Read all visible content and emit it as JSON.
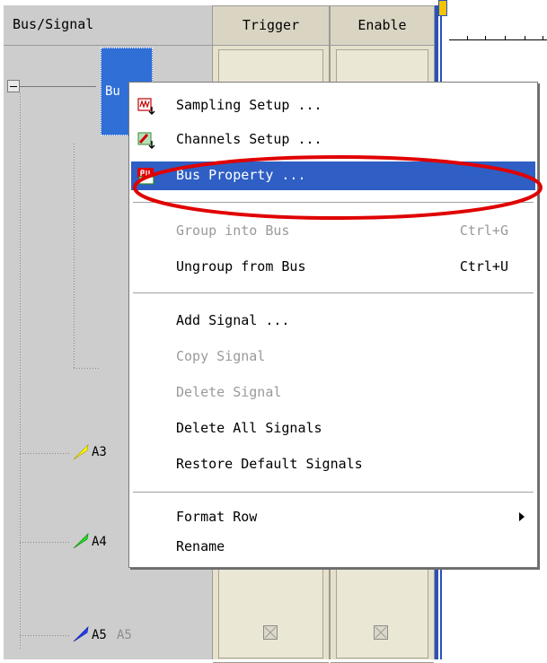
{
  "columns": {
    "bus_signal": "Bus/Signal",
    "trigger": "Trigger",
    "enable": "Enable"
  },
  "tree": {
    "bus_label": "Bu",
    "signals": [
      {
        "name": "A3",
        "color": "#ffff00"
      },
      {
        "name": "A4",
        "color": "#22dd22"
      },
      {
        "name": "A5",
        "alias": "A5",
        "color": "#1f3fff"
      }
    ]
  },
  "menu": {
    "items": [
      {
        "label": "Sampling Setup ...",
        "icon": "sampling-icon",
        "enabled": true
      },
      {
        "label": "Channels Setup ...",
        "icon": "channels-icon",
        "enabled": true
      },
      {
        "label": "Bus Property ...",
        "icon": "bus-property-icon",
        "enabled": true,
        "selected": true
      },
      {
        "label": "Group into Bus",
        "shortcut": "Ctrl+G",
        "enabled": false
      },
      {
        "label": "Ungroup from Bus",
        "shortcut": "Ctrl+U",
        "enabled": true
      },
      {
        "label": "Add Signal ...",
        "enabled": true
      },
      {
        "label": "Copy Signal",
        "enabled": false
      },
      {
        "label": "Delete Signal",
        "enabled": false
      },
      {
        "label": "Delete All Signals",
        "enabled": true
      },
      {
        "label": "Restore Default Signals",
        "enabled": true
      },
      {
        "label": "Format Row",
        "enabled": true,
        "submenu": true
      },
      {
        "label": "Rename",
        "enabled": true
      }
    ]
  },
  "colors": {
    "selection": "#2f5fc4",
    "highlight_ellipse": "#e00000",
    "bus_cell": "#2f6fd6"
  }
}
